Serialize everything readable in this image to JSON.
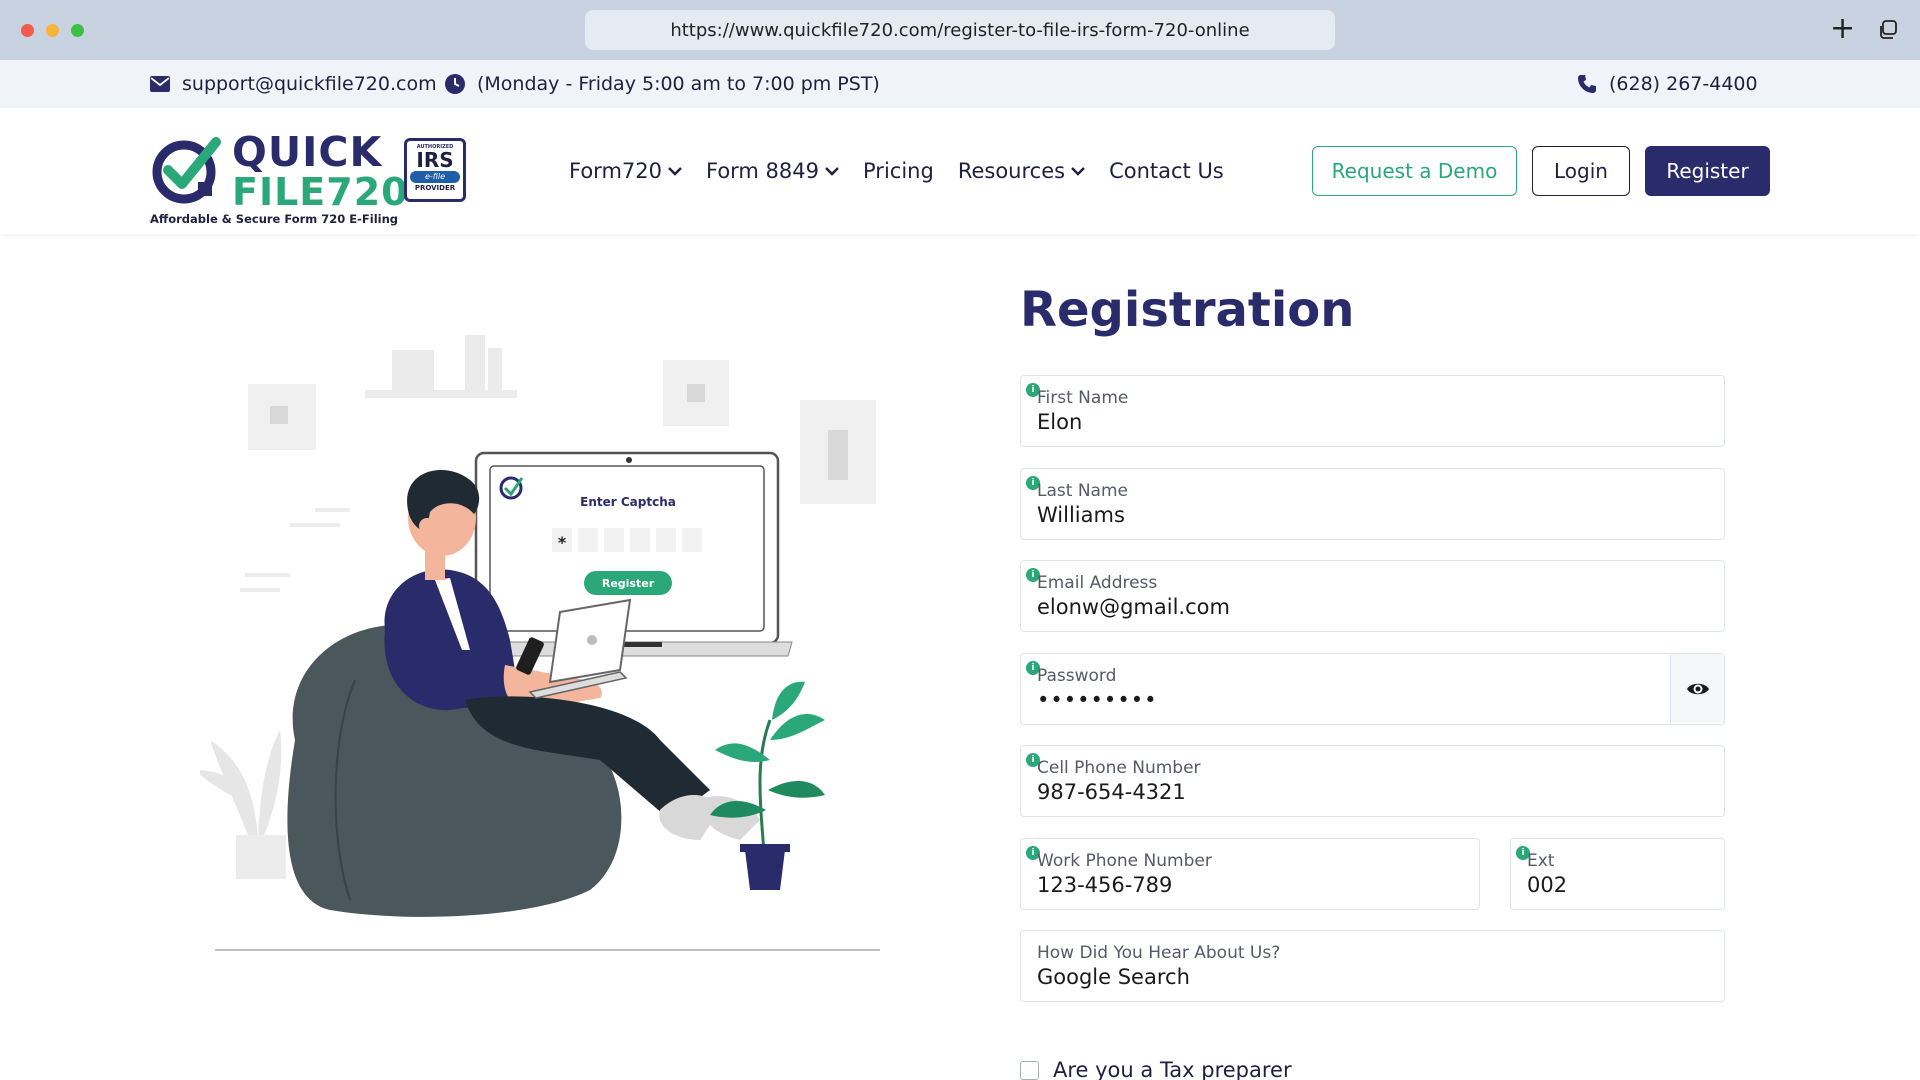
{
  "browser": {
    "url": "https://www.quickfile720.com/register-to-file-irs-form-720-online",
    "new_tab_icon": "plus-icon",
    "tabs_icon": "tabs-icon"
  },
  "infobar": {
    "email": "support@quickfile720.com",
    "hours": "(Monday - Friday 5:00 am to 7:00 pm PST)",
    "phone": "(628) 267-4400"
  },
  "logo": {
    "line1": "QUICK",
    "line2": "FILE720",
    "tagline": "Affordable & Secure Form 720 E-Filing",
    "badge_top": "AUTHORIZED",
    "badge_main": "IRS",
    "badge_efile": "e-file",
    "badge_bottom": "PROVIDER"
  },
  "nav": {
    "items": [
      {
        "label": "Form720",
        "dropdown": true
      },
      {
        "label": "Form 8849",
        "dropdown": true
      },
      {
        "label": "Pricing",
        "dropdown": false
      },
      {
        "label": "Resources",
        "dropdown": true
      },
      {
        "label": "Contact Us",
        "dropdown": false
      }
    ],
    "demo_label": "Request a Demo",
    "login_label": "Login",
    "register_label": "Register"
  },
  "illustration": {
    "captcha_title": "Enter Captcha",
    "captcha_char": "*",
    "captcha_button": "Register"
  },
  "form": {
    "title": "Registration",
    "fields": {
      "first_name": {
        "label": "First Name",
        "value": "Elon"
      },
      "last_name": {
        "label": "Last Name",
        "value": "Williams"
      },
      "email": {
        "label": "Email Address",
        "value": "elonw@gmail.com"
      },
      "password": {
        "label": "Password",
        "value": "•••••••••"
      },
      "cell_phone": {
        "label": "Cell Phone Number",
        "value": "987-654-4321"
      },
      "work_phone": {
        "label": "Work Phone Number",
        "value": "123-456-789"
      },
      "ext": {
        "label": "Ext",
        "value": "002"
      },
      "hear_about": {
        "label": "How Did You Hear About Us?",
        "value": "Google Search"
      }
    },
    "tax_preparer_label": "Are you a Tax preparer",
    "info_glyph": "i"
  },
  "colors": {
    "brand_navy": "#2a2b6b",
    "brand_green": "#2aa87a",
    "chrome_bg": "#c9d2e0"
  }
}
